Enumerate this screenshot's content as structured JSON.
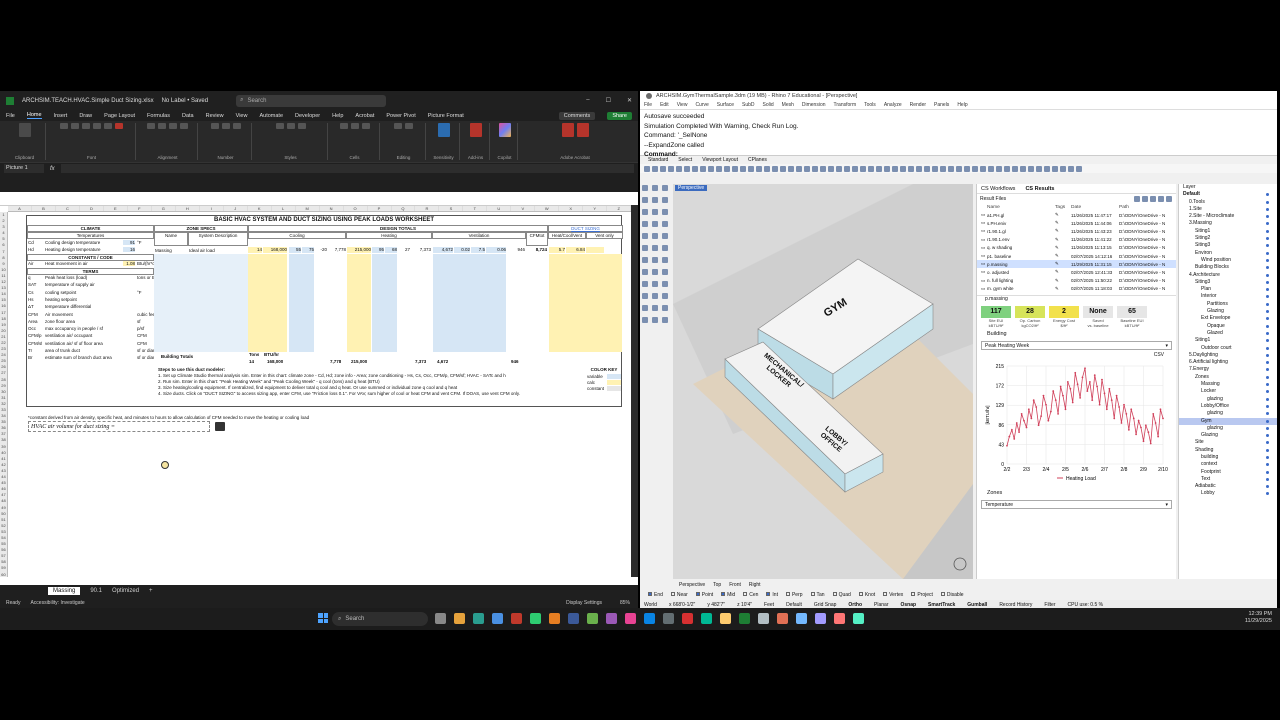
{
  "excel": {
    "window_title": "ARCHSIM.TEACH.HVAC.Simple Duct Sizing.xlsx",
    "label_status": "No Label • Saved",
    "search_placeholder": "Search",
    "menu": [
      "File",
      "Home",
      "Insert",
      "Draw",
      "Page Layout",
      "Formulas",
      "Data",
      "Review",
      "View",
      "Automate",
      "Developer",
      "Help",
      "Acrobat",
      "Power Pivot",
      "Picture Format"
    ],
    "comments_label": "Comments",
    "share_label": "Share",
    "ribbon_groups": [
      "Clipboard",
      "Font",
      "Alignment",
      "Number",
      "Styles",
      "Cells",
      "Editing",
      "Sensitivity",
      "Add-ins",
      "",
      "Adobe Acrobat"
    ],
    "ribbon_buttons": {
      "paste": "Paste",
      "sensitivity": "Sensitivity",
      "addins": "Add-ins",
      "copilot": "Copilot",
      "create_pdf": "Create PDF and Share link",
      "create_pdf_outlook": "Create PDF and Share via Outlook"
    },
    "name_box": "Picture 1",
    "sheet": {
      "title": "BASIC HVAC SYSTEM AND DUCT SIZING USING PEAK LOADS WORKSHEET",
      "climate": "CLIMATE",
      "temperatures": "Temperatures",
      "zone_specs": "ZONE SPECS",
      "design_totals": "DESIGN TOTALS",
      "duct_sizing": "DUCT SIZING",
      "cooling": "Cooling",
      "heating": "Heating",
      "ventilation": "Ventilation",
      "name": "Name",
      "system_description": "System Description",
      "cfm_tot": "CFMtot",
      "heat_cool_vent": "Heat/Cool/Vent",
      "vent_only": "Vent only",
      "rows": [
        {
          "code": "Cd",
          "label": "Cooling design temperature",
          "value": "91",
          "unit": "°F"
        },
        {
          "code": "Hd",
          "label": "Heating design temperature",
          "value": "16",
          "unit": ""
        }
      ],
      "constants": "CONSTANTS / CODE",
      "air_row": {
        "code": "Air",
        "label": "Heat movement in air",
        "value": "1.08",
        "unit": "Btu/(hr*cfm*°F)"
      },
      "terms": "TERMS",
      "terms_rows": [
        {
          "code": "q",
          "label": "Peak heat loss (load)",
          "unit": "tons or BTU/hr"
        },
        {
          "code": "SAT",
          "label": "temperature of supply air",
          "unit": ""
        },
        {
          "code": "Cs",
          "label": "cooling setpoint",
          "unit": "°F"
        },
        {
          "code": "Hs",
          "label": "heating setpoint",
          "unit": ""
        },
        {
          "code": "ΔT",
          "label": "temperature differential",
          "unit": ""
        },
        {
          "code": "CFM",
          "label": "Air movement",
          "unit": "cubic feet/min"
        },
        {
          "code": "Area",
          "label": "zone floor area",
          "unit": "sf"
        },
        {
          "code": "Occ",
          "label": "max occupancy in people / sf",
          "unit": "p/sf"
        },
        {
          "code": "CFM/p",
          "label": "ventilation air/ occupant",
          "unit": "CFM"
        },
        {
          "code": "CFM/sf",
          "label": "ventilation air/ sf of floor area",
          "unit": "CFM"
        },
        {
          "code": "Tr",
          "label": "area of trunk duct",
          "unit": "sf or diam\""
        },
        {
          "code": "Br",
          "label": "estimate sum of branch duct area",
          "unit": "sf or diam\""
        }
      ],
      "zone_row": {
        "name": "Massing",
        "desc": "Ideal air load",
        "tons": "14",
        "btu": "168,000",
        "satc": "55",
        "cs": "75",
        "dt": "-20",
        "cfm_c": "7,778",
        "q_heat": "215,000",
        "sath": "95",
        "hs": "68",
        "dth": "27",
        "cfm_h": "7,373",
        "area": "4,672",
        "occ": "0.02",
        "cfmp": "7.5",
        "cfmsf": "0.06",
        "cfm_v": "946",
        "cfm_tot": "8,724",
        "tr": "5.7",
        "br": "6.84",
        "vent_br": "6"
      },
      "building_totals": "Building Totals",
      "totals": {
        "tons_lbl": "Tons",
        "btu_lbl": "BTU/hr",
        "tons": "14",
        "btu": "168,000",
        "cfm_c": "7,778",
        "btu_h": "215,000",
        "cfm_h": "7,373",
        "area": "4,672",
        "cfm_v": "946"
      },
      "steps_title": "Steps to use this duct modeler:",
      "steps": [
        "1. Set up Climate Studio thermal analysis sim. Enter in this chart: climate zone - Cd, Hd; zone info - Area; zone conditioning - Hs, Cs, Occ, CFM/p, CFM/sf; HVAC - SATc and h",
        "2. Run sim. Enter in this chart: \"Peak Heating Week\" and \"Peak Cooling Week\" - q cool (tons) and q heat (BTU)",
        "3. Size heating/cooling equipment. If centralized, find equipment to deliver total q cool and q heat. Or use summed or individual zone q cool and q heat",
        "4. Size ducts. Click on \"DUCT SIZING\" to access sizing app, enter CFM, use \"Friction loss 0.1\". For VAV, sum higher of cool or heat CFM and vent CFM. If DOAS, use vent CFM only."
      ],
      "color_key": "COLOR KEY",
      "color_key_items": [
        "variable",
        "calc",
        "constant"
      ],
      "note": "*constant derived from air density, specific heat, and minutes to hours to allow calculation of CFM needed to move the heating or cooling load",
      "formula_label": "HVAC air volume for duct sizing ="
    },
    "tabs": [
      "Massing",
      "90.1",
      "Optimized"
    ],
    "status": {
      "ready": "Ready",
      "accessibility": "Accessibility: Investigate",
      "display": "Display Settings",
      "zoom": "85%"
    }
  },
  "rhino": {
    "window_title": "ARCHSIM.GymThermalSample.3dm (19 MB) - Rhino 7 Educational - [Perspective]",
    "menu": [
      "File",
      "Edit",
      "View",
      "Curve",
      "Surface",
      "SubD",
      "Solid",
      "Mesh",
      "Dimension",
      "Transform",
      "Tools",
      "Analyze",
      "Render",
      "Panels",
      "Help"
    ],
    "command_history": [
      "Autosave succeeded",
      "Simulation Completed With Warning, Check Run Log.",
      "Command: '_SelNone",
      "--ExpandZone called"
    ],
    "command_prompt": "Command:",
    "toolbar_tabs": [
      "Standard",
      "Select",
      "Viewport Layout",
      "CPlanes"
    ],
    "viewport_label": "Perspective",
    "viewport_tabs": [
      "Perspective",
      "Top",
      "Front",
      "Right"
    ],
    "zone_labels": [
      "GYM",
      "MECHANICAL/ LOCKER",
      "LOBBY/ OFFICE"
    ],
    "osnaps": [
      "End",
      "Near",
      "Point",
      "Mid",
      "Cen",
      "Int",
      "Perp",
      "Tan",
      "Quad",
      "Knot",
      "Vertex",
      "Project",
      "Disable"
    ],
    "status": {
      "world": "World",
      "x": "x 668'0-1/2\"",
      "y": "y 482'7\"",
      "z": "z 10'4\"",
      "units": "Feet",
      "layer": "Default",
      "items": [
        "Grid Snap",
        "Ortho",
        "Planar",
        "Osnap",
        "SmartTrack",
        "Gumball",
        "Record History",
        "Filter",
        "CPU use: 0.5 %"
      ]
    },
    "panel": {
      "tabs": [
        "CS Workflows",
        "CS Results"
      ],
      "result_files": "Result Files",
      "columns": [
        "Name",
        "Tags",
        "Date",
        "Path"
      ],
      "files": [
        {
          "name": "a1.PH.gl",
          "date": "11/26/2025 11:47:17",
          "path": "D:\\ODNY\\OneDrive - N"
        },
        {
          "name": "s.PH.eniv",
          "date": "11/26/2025 11:44:06",
          "path": "D:\\ODNY\\OneDrive - N"
        },
        {
          "name": "r1.90.1.gl",
          "date": "11/26/2025 11:43:23",
          "path": "D:\\ODNY\\OneDrive - N"
        },
        {
          "name": "r1.90.1.env",
          "date": "11/26/2025 11:41:22",
          "path": "D:\\ODNY\\OneDrive - N"
        },
        {
          "name": "q. w shading",
          "date": "11/26/2025 11:13:15",
          "path": "D:\\ODNY\\OneDrive - N"
        },
        {
          "name": "p1. baseline",
          "date": "02/07/2025 14:12:16",
          "path": "D:\\ODNY\\OneDrive - N"
        },
        {
          "name": "p.massing",
          "date": "11/29/2025 11:31:15",
          "path": "D:\\ODNY\\OneDrive - N"
        },
        {
          "name": "o. adjusted",
          "date": "02/07/2025 12:41:33",
          "path": "D:\\ODNY\\OneDrive - N"
        },
        {
          "name": "n. full lighting",
          "date": "02/07/2025 11:50:22",
          "path": "D:\\ODNY\\OneDrive - N"
        },
        {
          "name": "m. gym white",
          "date": "02/07/2025 11:18:03",
          "path": "D:\\ODNY\\OneDrive - N"
        }
      ],
      "selected_result": "p.massing",
      "metrics": [
        {
          "value": "117",
          "label": "Site EUI",
          "unit": "kBTU/ft²",
          "color": "#7fd17f"
        },
        {
          "value": "28",
          "label": "Op. Carbon",
          "unit": "kgCO2/ft²",
          "color": "#d7e45a"
        },
        {
          "value": "2",
          "label": "Energy Cost",
          "unit": "$/ft²",
          "color": "#f2e14c"
        },
        {
          "value": "None",
          "label": "Saved",
          "unit": "vs. baseline",
          "color": "#e6e6e6"
        },
        {
          "value": "65",
          "label": "Baseline EUI",
          "unit": "kBTU/ft²",
          "color": "#e6e6e6"
        }
      ],
      "building": "Building",
      "dropdown": "Peak Heating Week",
      "csv": "CSV",
      "zones": "Zones",
      "zones_dropdown": "Temperature"
    },
    "layers": [
      {
        "label": "Layer",
        "indent": 0
      },
      {
        "label": "Default",
        "indent": 0,
        "bold": true
      },
      {
        "label": "0.Tools",
        "indent": 1
      },
      {
        "label": "1.Site",
        "indent": 1
      },
      {
        "label": "2.Site - Microclimate",
        "indent": 1
      },
      {
        "label": "3.Massing",
        "indent": 1
      },
      {
        "label": "Siting1",
        "indent": 2
      },
      {
        "label": "Siting2",
        "indent": 2
      },
      {
        "label": "Siting3",
        "indent": 2
      },
      {
        "label": "Environ",
        "indent": 2
      },
      {
        "label": "Wind position",
        "indent": 3
      },
      {
        "label": "Building Blocks",
        "indent": 2
      },
      {
        "label": "4.Architecture",
        "indent": 1
      },
      {
        "label": "Siting3",
        "indent": 2
      },
      {
        "label": "Plan",
        "indent": 3
      },
      {
        "label": "Interior",
        "indent": 3
      },
      {
        "label": "Partitions",
        "indent": 4
      },
      {
        "label": "Glazing",
        "indent": 4
      },
      {
        "label": "Ext Envelope",
        "indent": 3
      },
      {
        "label": "Opaque",
        "indent": 4
      },
      {
        "label": "Glazed",
        "indent": 4
      },
      {
        "label": "Siting1",
        "indent": 2
      },
      {
        "label": "Outdoor court",
        "indent": 3
      },
      {
        "label": "5.Daylighting",
        "indent": 1
      },
      {
        "label": "6.Artificial lighting",
        "indent": 1
      },
      {
        "label": "7.Energy",
        "indent": 1
      },
      {
        "label": "Zones",
        "indent": 2
      },
      {
        "label": "Massing",
        "indent": 3
      },
      {
        "label": "Locker",
        "indent": 3
      },
      {
        "label": "glazing",
        "indent": 4
      },
      {
        "label": "Lobby/Office",
        "indent": 3
      },
      {
        "label": "glazing",
        "indent": 4
      },
      {
        "label": "Gym",
        "indent": 3,
        "sel": true
      },
      {
        "label": "glazing",
        "indent": 4
      },
      {
        "label": "Glazing",
        "indent": 3
      },
      {
        "label": "Site",
        "indent": 2
      },
      {
        "label": "Shading",
        "indent": 2
      },
      {
        "label": "building",
        "indent": 3
      },
      {
        "label": "context",
        "indent": 3
      },
      {
        "label": "Footprint",
        "indent": 3
      },
      {
        "label": "Text",
        "indent": 3
      },
      {
        "label": "Adiabatic",
        "indent": 2
      },
      {
        "label": "Lobby",
        "indent": 3
      }
    ]
  },
  "chart_data": {
    "type": "line",
    "title": "",
    "xlabel": "",
    "ylabel": "[kBTU/hr]",
    "ylim": [
      0,
      215
    ],
    "yticks": [
      0,
      43,
      86,
      129,
      172,
      215
    ],
    "xticks": [
      "2/2",
      "2/3",
      "2/4",
      "2/5",
      "2/6",
      "2/7",
      "2/8",
      "2/9",
      "2/10"
    ],
    "series": [
      {
        "name": "Heating Load",
        "color": "#d0405a",
        "x": [
          2.0,
          2.12,
          2.25,
          2.37,
          2.5,
          2.62,
          2.75,
          2.87,
          3.0,
          3.12,
          3.25,
          3.37,
          3.5,
          3.62,
          3.75,
          3.87,
          4.0,
          4.12,
          4.25,
          4.37,
          4.5,
          4.62,
          4.75,
          4.87,
          5.0,
          5.12,
          5.25,
          5.37,
          5.5,
          5.62,
          5.75,
          5.87,
          6.0,
          6.12,
          6.25,
          6.37,
          6.5,
          6.62,
          6.75,
          6.87,
          7.0,
          7.12,
          7.25,
          7.37,
          7.5,
          7.62,
          7.75,
          7.87,
          8.0,
          8.12,
          8.25,
          8.37,
          8.5,
          8.62,
          8.75,
          8.87,
          9.0,
          9.12,
          9.25,
          9.37,
          9.5,
          9.62,
          9.75,
          9.87,
          10.0
        ],
        "values": [
          40,
          60,
          75,
          55,
          90,
          70,
          110,
          95,
          80,
          120,
          100,
          140,
          125,
          85,
          105,
          150,
          130,
          95,
          115,
          160,
          140,
          110,
          170,
          150,
          120,
          180,
          165,
          135,
          200,
          175,
          145,
          190,
          210,
          160,
          180,
          140,
          195,
          170,
          130,
          185,
          155,
          120,
          165,
          140,
          100,
          150,
          125,
          90,
          130,
          110,
          75,
          120,
          100,
          65,
          95,
          80,
          50,
          85,
          70,
          45,
          110,
          90,
          60,
          120,
          100
        ]
      }
    ]
  },
  "taskbar": {
    "search": "Search",
    "time": "12:39 PM",
    "date": "11/29/2025"
  }
}
